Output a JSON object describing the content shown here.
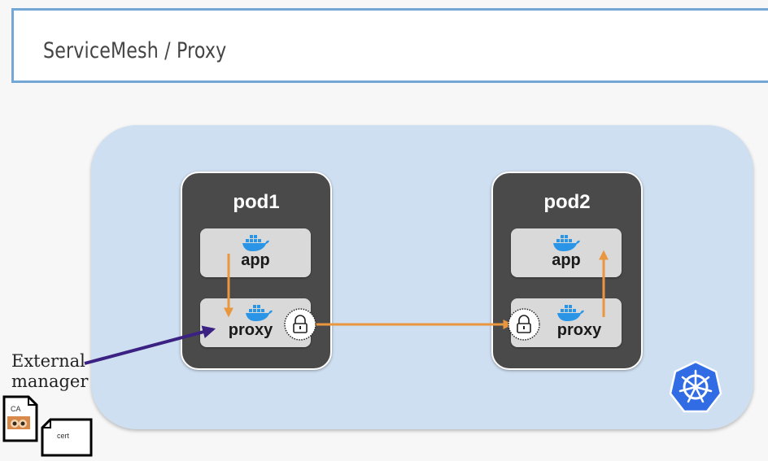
{
  "title": "ServiceMesh / Proxy",
  "pods": [
    {
      "name": "pod1",
      "app_label": "app",
      "proxy_label": "proxy"
    },
    {
      "name": "pod2",
      "app_label": "app",
      "proxy_label": "proxy"
    }
  ],
  "external_manager": {
    "line1": "External",
    "line2": "manager"
  },
  "documents": {
    "ca_label": "CA",
    "cert_label": "cert"
  },
  "icons": [
    "docker-whale-icon",
    "lock-icon",
    "kubernetes-helm-icon",
    "document-icon",
    "seal-icon"
  ],
  "colors": {
    "flow_arrow": "#e9963f",
    "manager_arrow": "#3b2282",
    "cluster_bg": "#cedff1",
    "pod_bg": "#4a4a4a",
    "k8s_blue": "#326ce5"
  }
}
